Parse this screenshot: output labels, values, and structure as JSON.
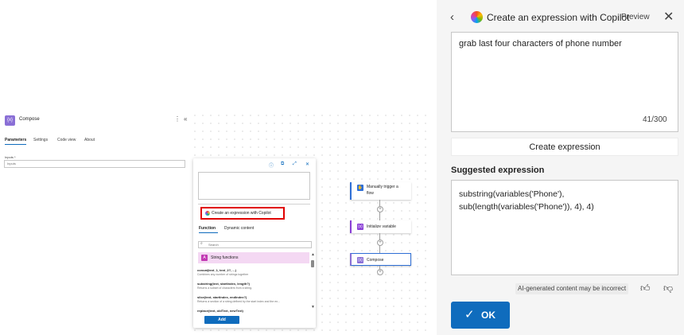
{
  "compose_panel": {
    "title": "Compose",
    "tabs": [
      "Parameters",
      "Settings",
      "Code view",
      "About"
    ],
    "inputs_label": "Inputs *",
    "inputs_placeholder": "Inputs",
    "icon": "compose-icon"
  },
  "expression_popup": {
    "copilot_button_label": "Create an expression with Copilot",
    "tabs": [
      "Function",
      "Dynamic content"
    ],
    "search_placeholder": "Search",
    "category": "String functions",
    "functions": [
      {
        "signature": "concat(text_1, text_2?, ...)",
        "description": "Combines any number of strings together"
      },
      {
        "signature": "substring(text, startIndex, length?)",
        "description": "Returns a subset of characters from a string."
      },
      {
        "signature": "slice(text, startIndex, endIndex?)",
        "description": "Returns a section of a string defined by the start index and the en..."
      },
      {
        "signature": "replace(text, oldText, newText)",
        "description": ""
      }
    ],
    "add_label": "Add"
  },
  "flow": {
    "nodes": [
      {
        "label": "Manually trigger a flow",
        "label_line1": "Manually trigger a",
        "label_line2": "flow",
        "color": "#2f6fd6"
      },
      {
        "label": "Initialize variable",
        "color": "#8a3fd6"
      },
      {
        "label": "Compose",
        "color": "#8a6fd6"
      }
    ]
  },
  "copilot": {
    "title": "Create an expression with Copilot",
    "badge": "Preview",
    "prompt": "grab last four characters of phone number",
    "counter": "41/300",
    "create_label": "Create expression",
    "suggested_title": "Suggested expression",
    "suggested_expression": "substring(variables('Phone'), sub(length(variables('Phone')), 4), 4)",
    "disclaimer": "AI-generated content may be incorrect",
    "ok_label": "OK"
  },
  "colors": {
    "accent": "#0f6cbd",
    "highlight_border": "#e00000",
    "category_bg": "#f4d8f3"
  }
}
